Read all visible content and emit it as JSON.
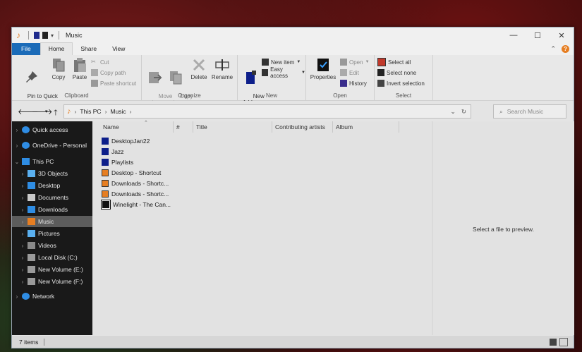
{
  "window": {
    "title": "Music"
  },
  "titlebar_buttons": {
    "minimize": "—",
    "maximize": "☐",
    "close": "✕"
  },
  "ribbon_tabs": [
    "File",
    "Home",
    "Share",
    "View"
  ],
  "ribbon": {
    "clipboard": {
      "label": "Clipboard",
      "pin": "Pin to Quick\naccess",
      "copy": "Copy",
      "paste": "Paste",
      "cut": "Cut",
      "copy_path": "Copy path",
      "paste_shortcut": "Paste shortcut"
    },
    "organize": {
      "label": "Organize",
      "move_to": "Move\nto",
      "copy_to": "Copy\nto",
      "delete": "Delete",
      "rename": "Rename"
    },
    "new": {
      "label": "New",
      "new_folder": "New\nfolder",
      "new_item": "New item",
      "easy_access": "Easy access"
    },
    "open": {
      "label": "Open",
      "properties": "Properties",
      "open": "Open",
      "edit": "Edit",
      "history": "History"
    },
    "select": {
      "label": "Select",
      "select_all": "Select all",
      "select_none": "Select none",
      "invert": "Invert selection"
    }
  },
  "address": {
    "crumbs": [
      "This PC",
      "Music"
    ],
    "search_placeholder": "Search Music"
  },
  "sidebar": {
    "items": [
      {
        "label": "Quick access",
        "icon": "star-icon"
      },
      {
        "label": "OneDrive - Personal",
        "icon": "cloud-icon"
      },
      {
        "label": "This PC",
        "icon": "computer-icon"
      },
      {
        "label": "3D Objects",
        "icon": "cube-icon"
      },
      {
        "label": "Desktop",
        "icon": "desktop-icon"
      },
      {
        "label": "Documents",
        "icon": "documents-icon"
      },
      {
        "label": "Downloads",
        "icon": "download-icon"
      },
      {
        "label": "Music",
        "icon": "music-icon"
      },
      {
        "label": "Pictures",
        "icon": "pictures-icon"
      },
      {
        "label": "Videos",
        "icon": "videos-icon"
      },
      {
        "label": "Local Disk (C:)",
        "icon": "drive-icon"
      },
      {
        "label": "New Volume (E:)",
        "icon": "drive-icon"
      },
      {
        "label": "New Volume (F:)",
        "icon": "drive-icon"
      },
      {
        "label": "Network",
        "icon": "network-icon"
      }
    ]
  },
  "columns": [
    "Name",
    "#",
    "Title",
    "Contributing artists",
    "Album"
  ],
  "files": [
    {
      "name": "DesktopJan22",
      "icon": "folder-icon"
    },
    {
      "name": "Jazz",
      "icon": "folder-icon"
    },
    {
      "name": "Playlists",
      "icon": "folder-icon"
    },
    {
      "name": "Desktop - Shortcut",
      "icon": "shortcut-icon"
    },
    {
      "name": "Downloads - Shortc...",
      "icon": "shortcut-icon"
    },
    {
      "name": "Downloads - Shortc...",
      "icon": "shortcut-icon"
    },
    {
      "name": "Winelight - The Can...",
      "icon": "audio-file-icon"
    }
  ],
  "preview": {
    "text": "Select a file to preview."
  },
  "status": {
    "count": "7 items"
  },
  "colors": {
    "file_tab": "#1b6bb8",
    "sidebar_bg": "#191919",
    "accent_orange": "#e67e22",
    "folder_blue": "#0d1f8a"
  }
}
